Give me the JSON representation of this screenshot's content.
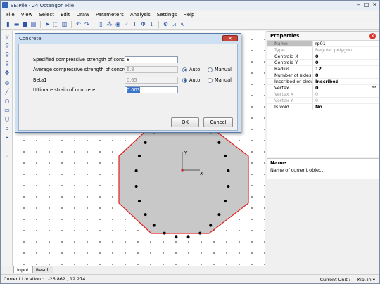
{
  "window": {
    "title": "SE:Pile - 24 Octangon Pile"
  },
  "menu": [
    "File",
    "View",
    "Select",
    "Edit",
    "Draw",
    "Parameters",
    "Analysis",
    "Settings",
    "Help"
  ],
  "dialog": {
    "title": "Concrete",
    "fields": [
      {
        "label": "Specified compressive strength of concrete",
        "value": "8"
      },
      {
        "label": "Average compressive strength of concrete",
        "value": "6.8",
        "mode": "Auto"
      },
      {
        "label": "Beta1",
        "value": "0.65",
        "mode": "Auto"
      },
      {
        "label": "Ultimate strain of concrete",
        "value": "0.003"
      }
    ],
    "auto_label": "Auto",
    "manual_label": "Manual",
    "ok_label": "OK",
    "cancel_label": "Cancel"
  },
  "canvas": {
    "axis_x": "X",
    "axis_y": "Y"
  },
  "properties": {
    "title": "Properties",
    "rows": [
      {
        "key": "Name",
        "value": "rp01"
      },
      {
        "key": "Type",
        "value": "Regular polygon"
      },
      {
        "key": "Centroid X",
        "value": "0"
      },
      {
        "key": "Centroid Y",
        "value": "0"
      },
      {
        "key": "Radius",
        "value": "12"
      },
      {
        "key": "Number of sides",
        "value": "8"
      },
      {
        "key": "Inscribed or circumsc",
        "value": "Inscribed"
      },
      {
        "key": "Vertex",
        "value": "0"
      },
      {
        "key": "Vertex X",
        "value": "0"
      },
      {
        "key": "Vertex Y",
        "value": "0"
      },
      {
        "key": "Is void",
        "value": "No"
      }
    ]
  },
  "name_panel": {
    "title": "Name",
    "desc": "Name of current object"
  },
  "tabs": [
    "Input",
    "Result"
  ],
  "status": {
    "location_label": "Current Location :",
    "location_value": "-26.862 , 12.274",
    "unit_label": "Current Unit :",
    "unit_value": "Kip, in"
  },
  "colors": {
    "octagon_fill": "#c8c8c8",
    "octagon_stroke": "#e02020",
    "accent": "#3a75c9"
  }
}
